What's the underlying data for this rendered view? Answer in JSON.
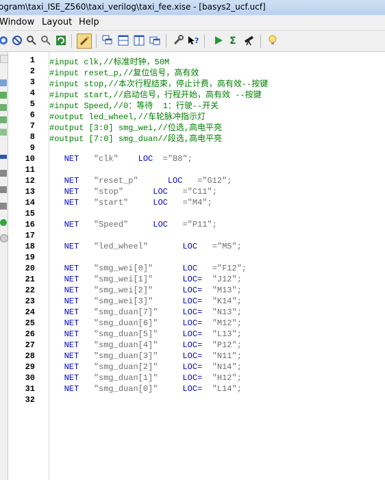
{
  "window": {
    "title": "ogram\\taxi_ISE_Z560\\taxi_verilog\\taxi_fee.xise - [basys2_ucf.ucf]"
  },
  "menu": {
    "items": [
      "Window",
      "Layout",
      "Help"
    ]
  },
  "toolbar": {
    "icons": [
      "print-preview-icon",
      "find-icon",
      "find-in-files-icon",
      "replace-icon",
      "refresh-icon",
      "highlight-icon",
      "cascade-icon",
      "tile-horizontal-icon",
      "tile-vertical-icon",
      "float-icon",
      "settings-wrench-icon",
      "help-cursor-icon",
      "run-icon",
      "sigma-icon",
      "telescope-icon",
      "lightbulb-icon"
    ]
  },
  "editor": {
    "lines": [
      {
        "num": "1",
        "text": "#input clk,//标准时钟，50M",
        "kind": "comment"
      },
      {
        "num": "2",
        "text": "#input reset_p,//复位信号，高有效",
        "kind": "comment"
      },
      {
        "num": "3",
        "text": "#input stop,//本次行程结束，停止计费，高有效--按键",
        "kind": "comment"
      },
      {
        "num": "4",
        "text": "#input start,//启动信号，行程开始，高有效 --按键",
        "kind": "comment"
      },
      {
        "num": "5",
        "text": "#input Speed,//0：等待  1：行驶--开关",
        "kind": "comment"
      },
      {
        "num": "6",
        "text": "#output led_wheel,//车轮脉冲指示灯",
        "kind": "comment"
      },
      {
        "num": "7",
        "text": "#output [3:0] smg_wei,//位选,高电平亮",
        "kind": "comment"
      },
      {
        "num": "8",
        "text": "#output [7:0] smg_duan//段选,高电平亮",
        "kind": "comment"
      },
      {
        "num": "9",
        "kind": "blank"
      },
      {
        "num": "10",
        "kind": "net",
        "net": "NET",
        "sig": "\"clk\"",
        "loc": "LOC",
        "val": "=\"B8\";",
        "sigPad": "    ",
        "locPad": "  "
      },
      {
        "num": "11",
        "kind": "blank"
      },
      {
        "num": "12",
        "kind": "net",
        "net": "NET",
        "sig": "\"reset_p\"",
        "loc": "LOC",
        "val": "=\"G12\";",
        "sigPad": "      ",
        "locPad": "   "
      },
      {
        "num": "13",
        "kind": "net",
        "net": "NET",
        "sig": "\"stop\"",
        "loc": "LOC",
        "val": "=\"C11\";",
        "sigPad": "      ",
        "locPad": "   "
      },
      {
        "num": "14",
        "kind": "net",
        "net": "NET",
        "sig": "\"start\"",
        "loc": "LOC",
        "val": "=\"M4\";",
        "sigPad": "     ",
        "locPad": "   "
      },
      {
        "num": "15",
        "kind": "blank"
      },
      {
        "num": "16",
        "kind": "net",
        "net": "NET",
        "sig": "\"Speed\"",
        "loc": "LOC",
        "val": "=\"P11\";",
        "sigPad": "     ",
        "locPad": "   "
      },
      {
        "num": "17",
        "kind": "blank"
      },
      {
        "num": "18",
        "kind": "net",
        "net": "NET",
        "sig": "\"led_wheel\"",
        "loc": "LOC",
        "val": "=\"M5\";",
        "sigPad": "       ",
        "locPad": "   "
      },
      {
        "num": "19",
        "kind": "blank"
      },
      {
        "num": "20",
        "kind": "net",
        "net": "NET",
        "sig": "\"smg_wei[0]\"",
        "loc": "LOC",
        "val": "=\"F12\";",
        "sigPad": "      ",
        "locPad": "   "
      },
      {
        "num": "21",
        "kind": "net",
        "net": "NET",
        "sig": "\"smg_wei[1]\"",
        "loc": "LOC=",
        "val": "\"J12\";",
        "sigPad": "      ",
        "locPad": "  "
      },
      {
        "num": "22",
        "kind": "net",
        "net": "NET",
        "sig": "\"smg_wei[2]\"",
        "loc": "LOC=",
        "val": "\"M13\";",
        "sigPad": "      ",
        "locPad": "  "
      },
      {
        "num": "23",
        "kind": "net",
        "net": "NET",
        "sig": "\"smg_wei[3]\"",
        "loc": "LOC=",
        "val": "\"K14\";",
        "sigPad": "      ",
        "locPad": "  "
      },
      {
        "num": "24",
        "kind": "net",
        "net": "NET",
        "sig": "\"smg_duan[7]\"",
        "loc": "LOC=",
        "val": "\"N13\";",
        "sigPad": "     ",
        "locPad": "  "
      },
      {
        "num": "25",
        "kind": "net",
        "net": "NET",
        "sig": "\"smg_duan[6]\"",
        "loc": "LOC=",
        "val": "\"M12\";",
        "sigPad": "     ",
        "locPad": "  "
      },
      {
        "num": "26",
        "kind": "net",
        "net": "NET",
        "sig": "\"smg_duan[5]\"",
        "loc": "LOC=",
        "val": "\"L13\";",
        "sigPad": "     ",
        "locPad": "  "
      },
      {
        "num": "27",
        "kind": "net",
        "net": "NET",
        "sig": "\"smg_duan[4]\"",
        "loc": "LOC=",
        "val": "\"P12\";",
        "sigPad": "     ",
        "locPad": "  "
      },
      {
        "num": "28",
        "kind": "net",
        "net": "NET",
        "sig": "\"smg_duan[3]\"",
        "loc": "LOC=",
        "val": "\"N11\";",
        "sigPad": "     ",
        "locPad": "  "
      },
      {
        "num": "29",
        "kind": "net",
        "net": "NET",
        "sig": "\"smg_duan[2]\"",
        "loc": "LOC=",
        "val": "\"N14\";",
        "sigPad": "     ",
        "locPad": "  "
      },
      {
        "num": "30",
        "kind": "net",
        "net": "NET",
        "sig": "\"smg_duan[1]\"",
        "loc": "LOC=",
        "val": "\"H12\";",
        "sigPad": "     ",
        "locPad": "  "
      },
      {
        "num": "31",
        "kind": "net",
        "net": "NET",
        "sig": "\"smg_duan[0]\"",
        "loc": "LOC=",
        "val": "\"L14\";",
        "sigPad": "     ",
        "locPad": "  "
      },
      {
        "num": "32",
        "kind": "blank"
      }
    ]
  }
}
